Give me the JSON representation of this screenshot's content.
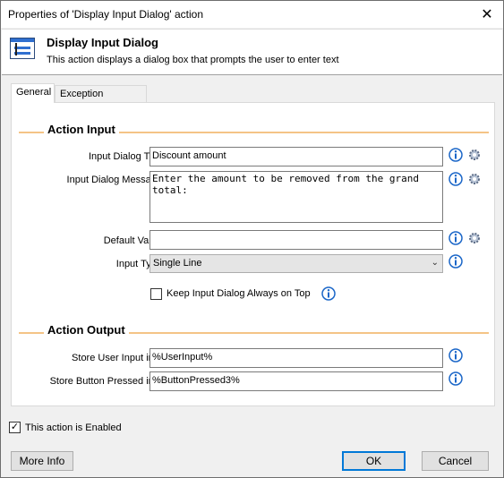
{
  "window": {
    "title": "Properties of 'Display Input Dialog' action",
    "close_glyph": "✕"
  },
  "header": {
    "title": "Display Input Dialog",
    "description": "This action displays a dialog box that prompts the user to enter text",
    "icon": "dialog-window-icon"
  },
  "tabs": [
    {
      "label": "General",
      "active": true
    },
    {
      "label": "Exception Handling",
      "active": false
    }
  ],
  "action_input": {
    "section_title": "Action Input",
    "dialog_title": {
      "label": "Input Dialog Title:",
      "value": "Discount amount"
    },
    "dialog_message": {
      "label": "Input Dialog Message:",
      "value": "Enter the amount to be removed from the grand total:"
    },
    "default_value": {
      "label": "Default Value:",
      "value": ""
    },
    "input_type": {
      "label": "Input Type:",
      "value": "Single Line"
    },
    "always_on_top": {
      "label": "Keep Input Dialog Always on Top",
      "checked": false
    }
  },
  "action_output": {
    "section_title": "Action Output",
    "store_input": {
      "label": "Store User Input into:",
      "value": "%UserInput%"
    },
    "store_button": {
      "label": "Store Button Pressed into:",
      "value": "%ButtonPressed3%"
    }
  },
  "enabled": {
    "label": "This action is Enabled",
    "checked": true,
    "mark": "✓"
  },
  "buttons": {
    "more_info": "More Info",
    "ok": "OK",
    "cancel": "Cancel"
  },
  "colors": {
    "section_line": "#f4c486",
    "info_blue": "#1a66c8",
    "default_button_border": "#0078d7"
  }
}
